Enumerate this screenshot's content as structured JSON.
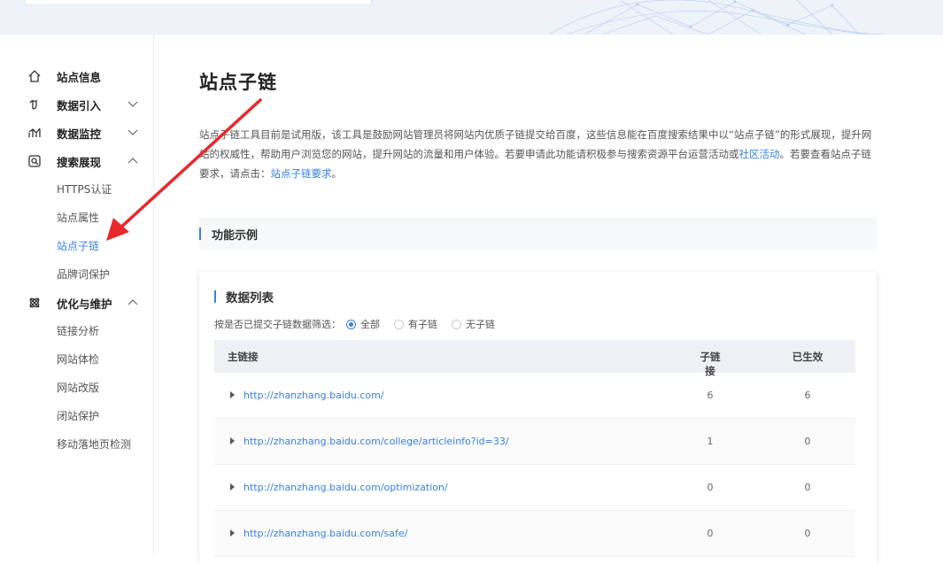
{
  "sidebar": {
    "groups": [
      {
        "label": "站点信息",
        "icon": "home-icon"
      },
      {
        "label": "数据引入",
        "icon": "data-import-icon"
      },
      {
        "label": "数据监控",
        "icon": "monitor-chart-icon"
      },
      {
        "label": "搜索展现",
        "icon": "search-display-icon"
      },
      {
        "label": "优化与维护",
        "icon": "optimize-icon"
      }
    ],
    "search_items": [
      "HTTPS认证",
      "站点属性",
      "站点子链",
      "品牌词保护"
    ],
    "optimize_items": [
      "链接分析",
      "网站体检",
      "网站改版",
      "闭站保护",
      "移动落地页检测"
    ]
  },
  "main": {
    "title": "站点子链",
    "desc_part1": "站点子链工具目前是试用版，该工具是鼓励网站管理员将网站内优质子链提交给百度，这些信息能在百度搜索结果中以“站点子链”的形式展现，提升网站的权威性，帮助用户浏览您的网站，提升网站的流量和用户体验。若要申请此功能请积极参与搜索资源平台运营活动或",
    "desc_link1": "社区活动",
    "desc_part2": "。若要查看站点子链要求，请点击：",
    "desc_link2": "站点子链要求",
    "desc_part3": "。",
    "section_title": "功能示例",
    "card_title": "数据列表",
    "filter_label": "按是否已提交子链数据筛选：",
    "filter_options": [
      "全部",
      "有子链",
      "无子链"
    ],
    "table": {
      "headers": [
        "主链接",
        "子链接",
        "已生效"
      ],
      "rows": [
        {
          "url": "http://zhanzhang.baidu.com/",
          "sub": "6",
          "active": "6"
        },
        {
          "url": "http://zhanzhang.baidu.com/college/articleinfo?id=33/",
          "sub": "1",
          "active": "0"
        },
        {
          "url": "http://zhanzhang.baidu.com/optimization/",
          "sub": "0",
          "active": "0"
        },
        {
          "url": "http://zhanzhang.baidu.com/safe/",
          "sub": "0",
          "active": "0"
        }
      ]
    }
  },
  "colors": {
    "accent": "#3a7fe0",
    "annotation_arrow": "#e8282b"
  }
}
